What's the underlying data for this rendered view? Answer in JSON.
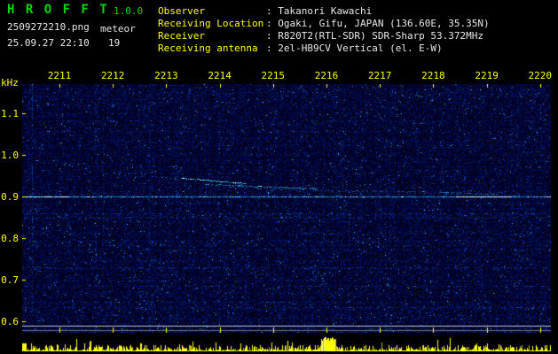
{
  "app": {
    "title": "H R O F F T",
    "version": "1.0.0",
    "filename": "2509272210.png",
    "mode": "meteor",
    "datetime": "25.09.27 22:10",
    "count": "19"
  },
  "station": {
    "rows": [
      {
        "label": "Observer",
        "value": ": Takanori Kawachi"
      },
      {
        "label": "Receiving Location",
        "value": ": Ogaki, Gifu, JAPAN (136.60E, 35.35N)"
      },
      {
        "label": "Receiver",
        "value": ": R820T2(RTL-SDR) SDR-Sharp 53.372MHz"
      },
      {
        "label": "Receiving antenna",
        "value": ": 2el-HB9CV Vertical (el. E-W)"
      }
    ]
  },
  "spectrogram": {
    "y_unit": "kHz",
    "x_ticks": [
      "2211",
      "2212",
      "2213",
      "2214",
      "2215",
      "2216",
      "2217",
      "2218",
      "2219",
      "2220"
    ],
    "y_ticks": [
      "1.1",
      "1.0",
      "0.9",
      "0.8",
      "0.7",
      "0.6"
    ],
    "carrier_freq_khz": "0.9",
    "colors": {
      "background": "#000022",
      "noise_blue": "#0040c0",
      "signal_cyan": "#00e0ff",
      "axis_yellow": "#ffff00",
      "title_green": "#00d800",
      "trace_white": "#c8c8dc"
    }
  }
}
